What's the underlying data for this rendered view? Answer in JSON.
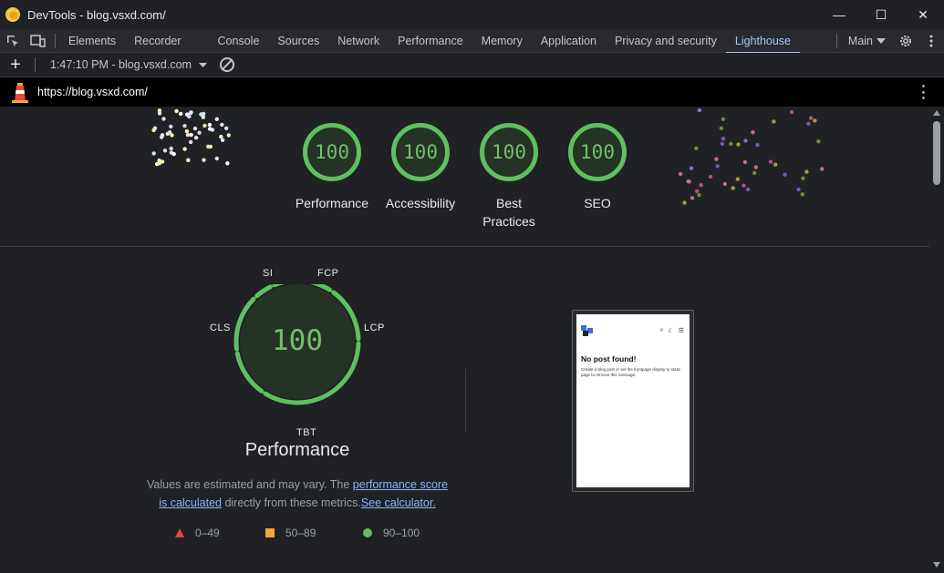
{
  "window": {
    "title": "DevTools - blog.vsxd.com/",
    "controls": {
      "minimize": "—",
      "maximize": "☐",
      "close": "✕"
    }
  },
  "tabs": [
    {
      "label": "Elements"
    },
    {
      "label": "Recorder"
    },
    {
      "label": "Console"
    },
    {
      "label": "Sources"
    },
    {
      "label": "Network"
    },
    {
      "label": "Performance"
    },
    {
      "label": "Memory"
    },
    {
      "label": "Application"
    },
    {
      "label": "Privacy and security"
    },
    {
      "label": "Lighthouse"
    }
  ],
  "active_tab": "Lighthouse",
  "tabbar_right": {
    "target_select": "Main"
  },
  "lighthouse_toolbar": {
    "add_label": "+",
    "report_select": "1:47:10 PM - blog.vsxd.com"
  },
  "url_bar": {
    "url": "https://blog.vsxd.com/"
  },
  "gauges": [
    {
      "score": "100",
      "label": "Performance"
    },
    {
      "score": "100",
      "label": "Accessibility"
    },
    {
      "score": "100",
      "label": "Best Practices"
    },
    {
      "score": "100",
      "label": "SEO"
    }
  ],
  "performance": {
    "score": "100",
    "title": "Performance",
    "metrics": {
      "si": "SI",
      "fcp": "FCP",
      "lcp": "LCP",
      "tbt": "TBT",
      "cls": "CLS"
    },
    "desc_before": "Values are estimated and may vary. The ",
    "desc_link1": "performance score is calculated",
    "desc_middle": " directly from these metrics.",
    "desc_link2": "See calculator."
  },
  "legend": [
    {
      "range": "0–49",
      "color": "#e04a3f"
    },
    {
      "range": "50–89",
      "color": "#f4a636"
    },
    {
      "range": "90–100",
      "color": "#5fc05f"
    }
  ],
  "screenshot": {
    "heading": "No post found!",
    "text": "Create a blog post or set the frontpage display to static page to remove this message."
  },
  "colors": {
    "pass": "#5fc05f",
    "accent": "#a8c7fa",
    "link": "#8ab4f8"
  }
}
